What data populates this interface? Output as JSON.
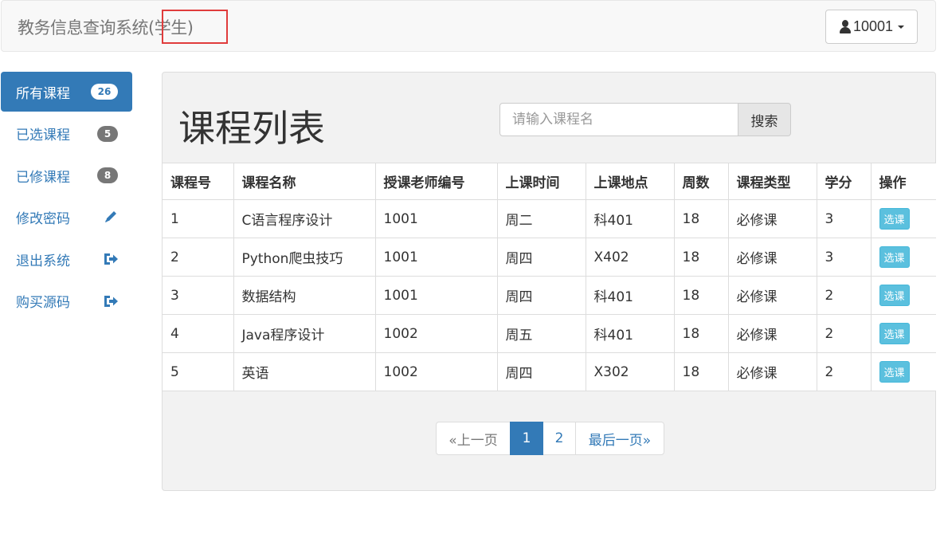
{
  "header": {
    "brand_main": "教务信息查询系统",
    "brand_role": "(学生)",
    "user_label": "10001"
  },
  "sidebar": {
    "items": [
      {
        "label": "所有课程",
        "badge": "26",
        "icon": "",
        "active": true
      },
      {
        "label": "已选课程",
        "badge": "5",
        "icon": ""
      },
      {
        "label": "已修课程",
        "badge": "8",
        "icon": ""
      },
      {
        "label": "修改密码",
        "badge": "",
        "icon": "pencil-icon"
      },
      {
        "label": "退出系统",
        "badge": "",
        "icon": "logout-icon"
      },
      {
        "label": "购买源码",
        "badge": "",
        "icon": "logout-icon"
      }
    ]
  },
  "main": {
    "title": "课程列表",
    "search_placeholder": "请输入课程名",
    "search_button": "搜索",
    "columns": [
      "课程号",
      "课程名称",
      "授课老师编号",
      "上课时间",
      "上课地点",
      "周数",
      "课程类型",
      "学分",
      "操作"
    ],
    "rows": [
      [
        "1",
        "C语言程序设计",
        "1001",
        "周二",
        "科401",
        "18",
        "必修课",
        "3"
      ],
      [
        "2",
        "Python爬虫技巧",
        "1001",
        "周四",
        "X402",
        "18",
        "必修课",
        "3"
      ],
      [
        "3",
        "数据结构",
        "1001",
        "周四",
        "科401",
        "18",
        "必修课",
        "2"
      ],
      [
        "4",
        "Java程序设计",
        "1002",
        "周五",
        "科401",
        "18",
        "必修课",
        "2"
      ],
      [
        "5",
        "英语",
        "1002",
        "周四",
        "X302",
        "18",
        "必修课",
        "2"
      ]
    ],
    "action_label": "选课"
  },
  "pagination": {
    "prev": "«上一页",
    "pages": [
      "1",
      "2"
    ],
    "current": "1",
    "last": "最后一页»"
  },
  "colors": {
    "primary": "#337ab7",
    "info": "#5bc0de",
    "highlight_box": "#e03c3c"
  }
}
